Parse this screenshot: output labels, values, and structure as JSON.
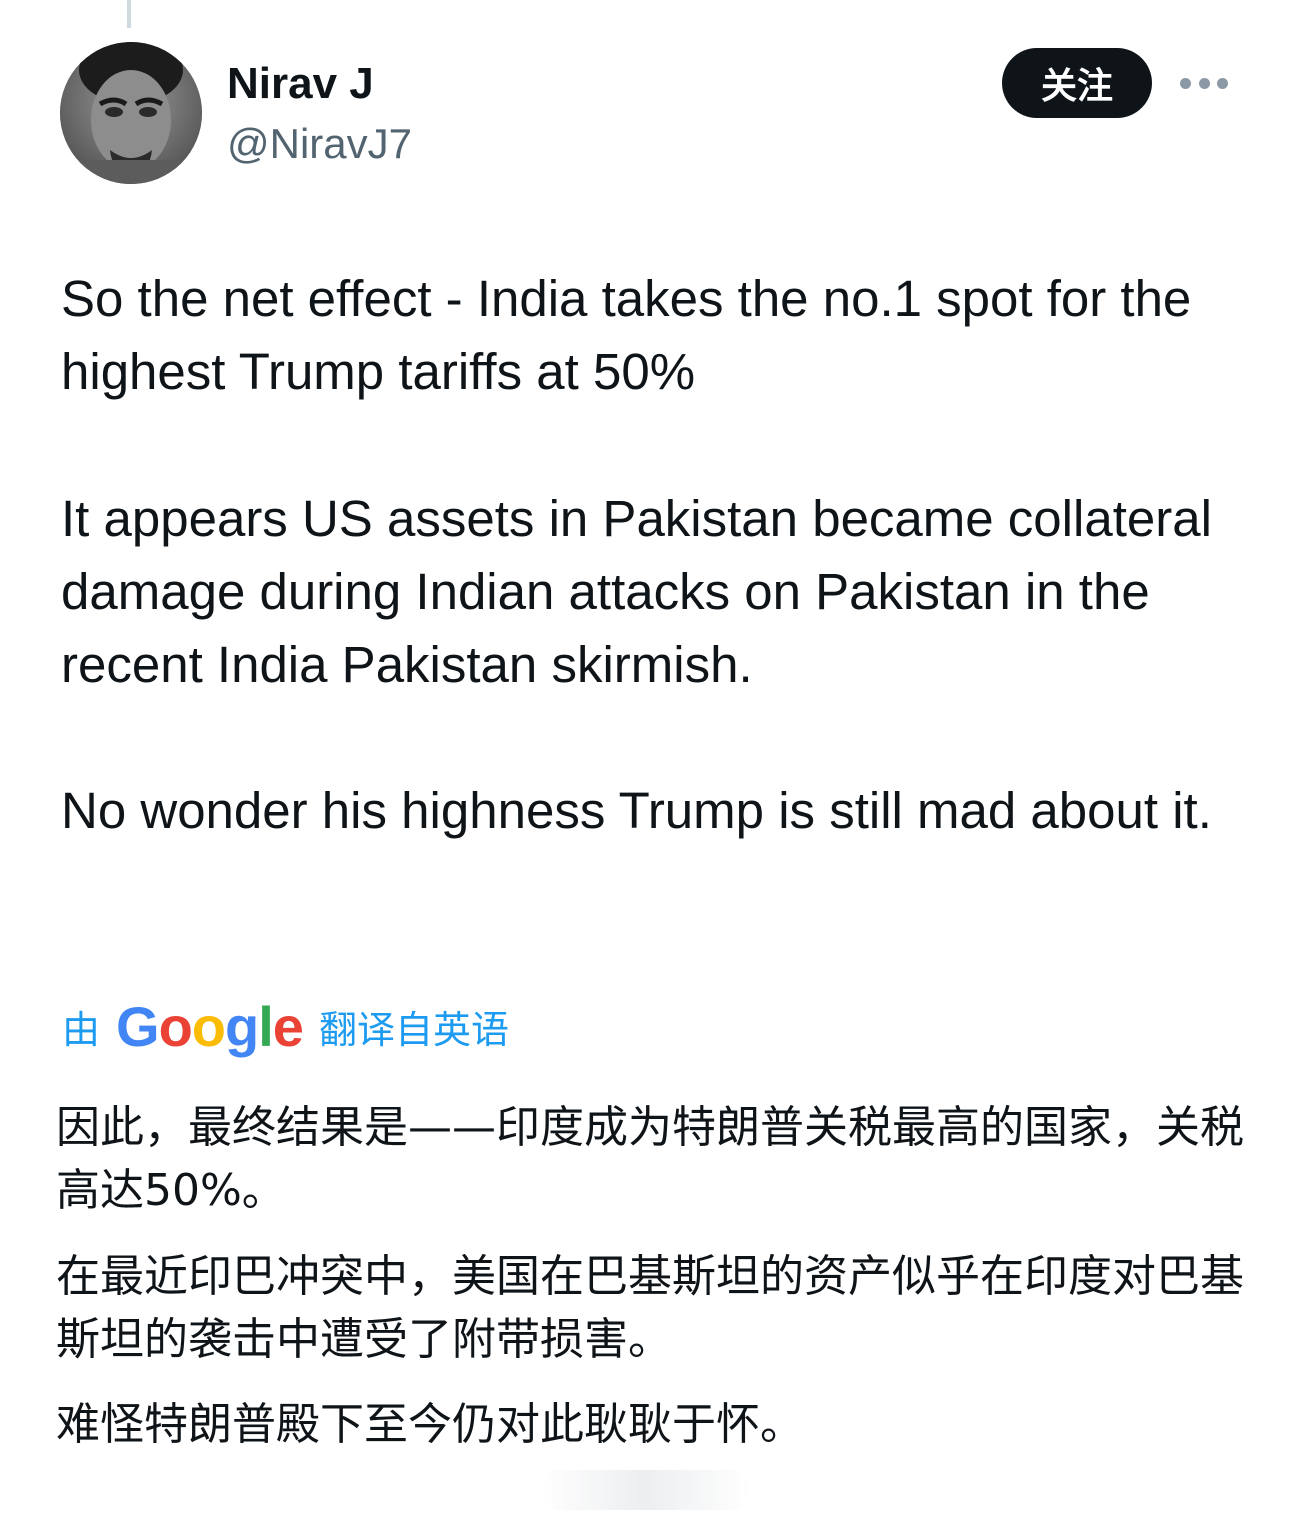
{
  "author": {
    "display_name": "Nirav J",
    "handle": "@NiravJ7",
    "avatar_icon": "user-avatar-photo"
  },
  "actions": {
    "follow_label": "关注",
    "more_icon": "more-horizontal-icon"
  },
  "tweet": {
    "paragraphs": [
      "So the net effect - India takes the no.1 spot for the highest Trump tariffs at 50%",
      "It appears US assets in Pakistan became collateral damage during Indian attacks on Pakistan in the recent India Pakistan skirmish.",
      "No wonder his highness Trump is still mad about it."
    ]
  },
  "translation": {
    "by_label": "由",
    "provider": "Google",
    "from_label": "翻译自英语",
    "paragraphs": [
      "因此，最终结果是——印度成为特朗普关税最高的国家，关税高达50%。",
      "在最近印巴冲突中，美国在巴基斯坦的资产似乎在印度对巴基斯坦的袭击中遭受了附带损害。",
      "难怪特朗普殿下至今仍对此耿耿于怀。"
    ]
  },
  "colors": {
    "link_blue": "#1d9bf0",
    "text": "#0f1419",
    "secondary_text": "#536471",
    "follow_bg": "#0f1419",
    "google_blue": "#4285F4",
    "google_red": "#EA4335",
    "google_yellow": "#FBBC05",
    "google_green": "#34A853"
  }
}
